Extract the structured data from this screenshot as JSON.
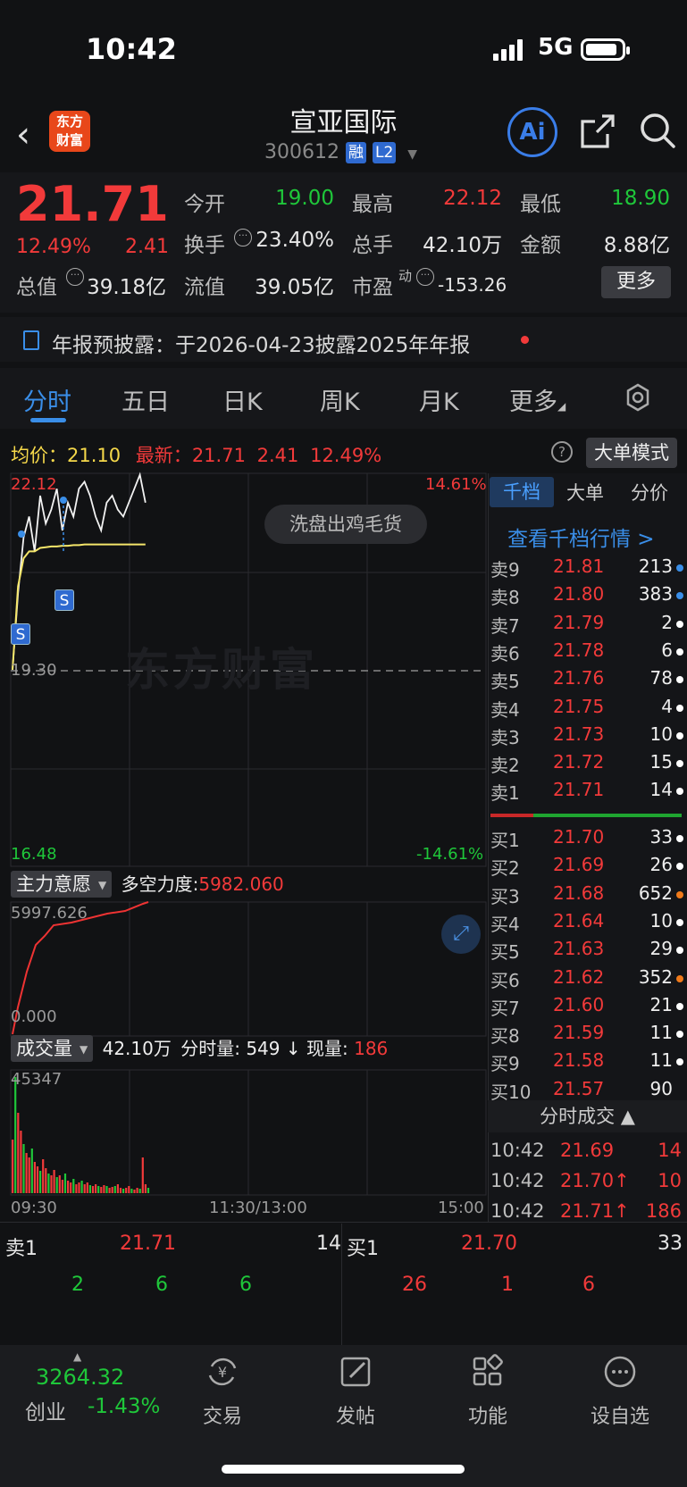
{
  "status_bar": {
    "time": "10:42",
    "network": "5G"
  },
  "header": {
    "logo_text_1": "东方",
    "logo_text_2": "财富",
    "name": "宣亚国际",
    "code": "300612",
    "tag_margin": "融",
    "tag_level": "L2",
    "ai_label": "Ai"
  },
  "quote": {
    "price": "21.71",
    "change_pct": "12.49%",
    "change": "2.41",
    "open_label": "今开",
    "open": "19.00",
    "high_label": "最高",
    "high": "22.12",
    "low_label": "最低",
    "low": "18.90",
    "turnover_label": "换手",
    "turnover": "23.40%",
    "volume_label": "总手",
    "volume": "42.10万",
    "amount_label": "金额",
    "amount": "8.88亿",
    "mktcap_label": "总值",
    "mktcap": "39.18亿",
    "float_label": "流值",
    "float_cap": "39.05亿",
    "pe_label": "市盈",
    "pe_sup": "动",
    "pe": "-153.26",
    "more_label": "更多"
  },
  "notice": {
    "text": "年报预披露：于2026-04-23披露2025年年报"
  },
  "tabs": [
    {
      "label": "分时"
    },
    {
      "label": "五日"
    },
    {
      "label": "日K"
    },
    {
      "label": "周K"
    },
    {
      "label": "月K"
    },
    {
      "label": "更多"
    }
  ],
  "info_line": {
    "avg_label": "均价：",
    "avg": "21.10",
    "latest_label": "最新：",
    "latest": "21.71",
    "change": "2.41",
    "change_pct": "12.49%",
    "big_mode": "大单模式"
  },
  "chart": {
    "y_top": "22.12",
    "y_mid": "19.30",
    "y_bottom": "16.48",
    "pct_top": "14.61%",
    "pct_bottom": "-14.61%",
    "pill": "洗盘出鸡毛货",
    "watermark": "东方财富",
    "signal_label": "S",
    "x_start": "09:30",
    "x_mid": "11:30/13:00",
    "x_end": "15:00"
  },
  "chart_data": {
    "type": "line",
    "series": [
      {
        "values": [
          19.3,
          20.4,
          21.2,
          21.5,
          21.0,
          21.8,
          21.4,
          21.6,
          21.9,
          21.3,
          21.7,
          21.5,
          21.9,
          22.0,
          21.8,
          21.5,
          21.3,
          21.7,
          21.8,
          21.6,
          21.5,
          21.7,
          21.9,
          22.1,
          21.7
        ]
      },
      {
        "values": [
          19.3,
          20.5,
          20.9,
          21.0,
          21.0,
          21.05,
          21.06,
          21.07,
          21.07,
          21.08,
          21.08,
          21.09,
          21.09,
          21.1,
          21.1,
          21.1,
          21.1,
          21.1,
          21.1,
          21.1,
          21.1,
          21.1,
          21.1,
          21.1,
          21.1
        ]
      }
    ],
    "ylim": [
      16.48,
      22.12
    ]
  },
  "main_force": {
    "dropdown": "主力意愿",
    "label": "多空力度:",
    "value": "5982.060",
    "y_top": "5997.626",
    "y_bottom": "0.000"
  },
  "volume_panel": {
    "dropdown": "成交量",
    "total": "42.10万",
    "minute_label": "分时量:",
    "minute": "549",
    "now_label": "现量:",
    "now": "186",
    "y_top": "45347"
  },
  "orderbook": {
    "tabs": [
      "千档",
      "大单",
      "分价"
    ],
    "view_link": "查看千档行情 >",
    "asks": [
      {
        "k": "卖9",
        "p": "21.81",
        "v": "213",
        "dot": "#3a8ee8"
      },
      {
        "k": "卖8",
        "p": "21.80",
        "v": "383",
        "dot": "#3a8ee8"
      },
      {
        "k": "卖7",
        "p": "21.79",
        "v": "2",
        "dot": "#ffffff"
      },
      {
        "k": "卖6",
        "p": "21.78",
        "v": "6",
        "dot": "#ffffff"
      },
      {
        "k": "卖5",
        "p": "21.76",
        "v": "78",
        "dot": "#ffffff"
      },
      {
        "k": "卖4",
        "p": "21.75",
        "v": "4",
        "dot": "#ffffff"
      },
      {
        "k": "卖3",
        "p": "21.73",
        "v": "10",
        "dot": "#ffffff"
      },
      {
        "k": "卖2",
        "p": "21.72",
        "v": "15",
        "dot": "#ffffff"
      },
      {
        "k": "卖1",
        "p": "21.71",
        "v": "14",
        "dot": "#ffffff"
      }
    ],
    "bids": [
      {
        "k": "买1",
        "p": "21.70",
        "v": "33",
        "dot": "#ffffff"
      },
      {
        "k": "买2",
        "p": "21.69",
        "v": "26",
        "dot": "#ffffff"
      },
      {
        "k": "买3",
        "p": "21.68",
        "v": "652",
        "dot": "#f07a1a"
      },
      {
        "k": "买4",
        "p": "21.64",
        "v": "10",
        "dot": "#ffffff"
      },
      {
        "k": "买5",
        "p": "21.63",
        "v": "29",
        "dot": "#ffffff"
      },
      {
        "k": "买6",
        "p": "21.62",
        "v": "352",
        "dot": "#f07a1a"
      },
      {
        "k": "买7",
        "p": "21.60",
        "v": "21",
        "dot": "#ffffff"
      },
      {
        "k": "买8",
        "p": "21.59",
        "v": "11",
        "dot": "#ffffff"
      },
      {
        "k": "买9",
        "p": "21.58",
        "v": "11",
        "dot": "#ffffff"
      },
      {
        "k": "买10",
        "p": "21.57",
        "v": "90",
        "dot": ""
      }
    ],
    "ticks_header": "分时成交 ▲",
    "ticks": [
      {
        "t": "10:42",
        "p": "21.69",
        "v": "14"
      },
      {
        "t": "10:42",
        "p": "21.70↑",
        "v": "10"
      },
      {
        "t": "10:42",
        "p": "21.71↑",
        "v": "186"
      }
    ]
  },
  "bottom_quote": {
    "sell_label": "卖1",
    "sell_price": "21.71",
    "sell_vol": "14",
    "buy_label": "买1",
    "buy_price": "21.70",
    "buy_vol": "33",
    "sell_queue": [
      "2",
      "6",
      "6"
    ],
    "buy_queue": [
      "26",
      "1",
      "6"
    ]
  },
  "nav": {
    "index_value": "3264.32",
    "index_name": "创业",
    "index_pct": "-1.43%",
    "items": [
      {
        "label": "交易"
      },
      {
        "label": "发帖"
      },
      {
        "label": "功能"
      },
      {
        "label": "设自选"
      }
    ]
  }
}
